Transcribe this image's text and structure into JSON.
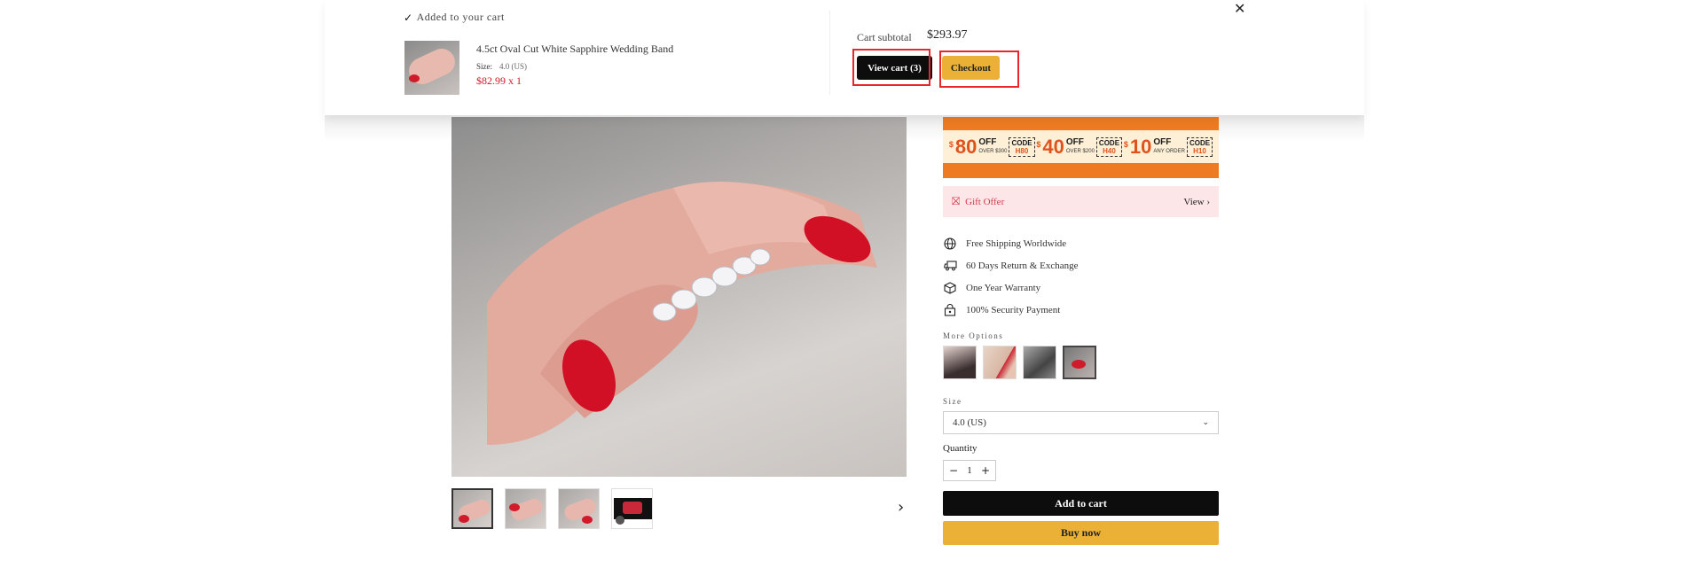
{
  "popup": {
    "added_text": "Added to your cart",
    "item_title": "4.5ct Oval Cut White Sapphire Wedding Band",
    "item_size_label": "Size:",
    "item_size_value": "4.0 (US)",
    "item_price_qty": "$82.99 x 1",
    "subtotal_label": "Cart subtotal",
    "subtotal_value": "$293.97",
    "view_cart_label": "View cart (3)",
    "checkout_label": "Checkout",
    "close_icon": "close-icon"
  },
  "promo": {
    "coupons": [
      {
        "currency": "$",
        "amount": "80",
        "off": "OFF",
        "condition": "OVER $300",
        "code_label": "CODE",
        "code": "H80"
      },
      {
        "currency": "$",
        "amount": "40",
        "off": "OFF",
        "condition": "OVER $200",
        "code_label": "CODE",
        "code": "H40"
      },
      {
        "currency": "$",
        "amount": "10",
        "off": "OFF",
        "condition": "ANY ORDER",
        "code_label": "CODE",
        "code": "H10"
      }
    ],
    "colors": {
      "band": "#ee7b22",
      "panel": "#fdf0d6",
      "amount": "#e0521b"
    }
  },
  "gift": {
    "label": "Gift Offer",
    "action": "View"
  },
  "features": [
    {
      "icon": "globe-icon",
      "text": "Free Shipping Worldwide"
    },
    {
      "icon": "truck-icon",
      "text": "60 Days Return & Exchange"
    },
    {
      "icon": "box-icon",
      "text": "One Year Warranty"
    },
    {
      "icon": "lock-icon",
      "text": "100% Security Payment"
    }
  ],
  "more_options_label": "More Options",
  "size": {
    "label": "Size",
    "selected": "4.0 (US)"
  },
  "quantity": {
    "label": "Quantity",
    "value": "1"
  },
  "buttons": {
    "add_to_cart": "Add to cart",
    "buy_now": "Buy now"
  },
  "colors": {
    "accent": "#ebb036",
    "dark_button": "#0d0d0d",
    "price": "#d0162a",
    "highlight": "#e8262b"
  }
}
